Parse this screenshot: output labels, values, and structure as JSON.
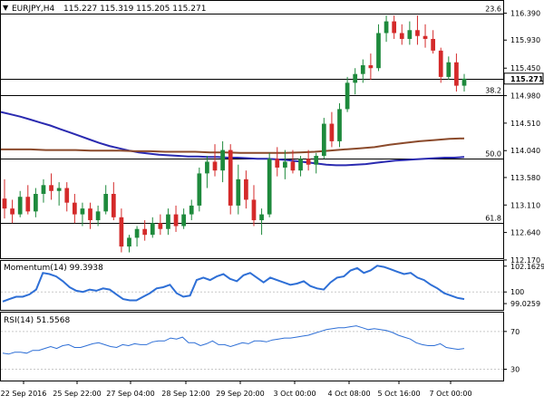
{
  "colors": {
    "bull": "#1e8a3c",
    "bear": "#d42a2a",
    "sma_blue": "#2a2ab0",
    "sma_brown": "#8b4a2b",
    "indicator": "#2e6fd6",
    "grid": "#c8c8c8",
    "frame": "#000000",
    "text": "#000000"
  },
  "header": {
    "symbol_timeframe": "EURJPY,H4",
    "ohlc": "115.227 115.319 115.205 115.271"
  },
  "chart_data": [
    {
      "type": "candlestick",
      "panel": "price",
      "ylim": [
        112.2,
        116.6
      ],
      "yticks": [
        "116.390",
        "115.930",
        "115.450",
        "114.980",
        "114.510",
        "114.040",
        "113.580",
        "113.110",
        "112.640",
        "112.170"
      ],
      "current_price": "115.271",
      "hlines": [
        {
          "label": "23.6",
          "value": 116.39
        },
        {
          "label": "38.2",
          "value": 114.99
        },
        {
          "label": "50.0",
          "value": 113.91
        },
        {
          "label": "61.8",
          "value": 112.81
        },
        {
          "label": "",
          "value": 115.27
        }
      ],
      "candles": [
        {
          "o": 113.22,
          "h": 113.55,
          "l": 112.88,
          "c": 113.05
        },
        {
          "o": 113.05,
          "h": 113.2,
          "l": 112.8,
          "c": 112.95
        },
        {
          "o": 112.95,
          "h": 113.35,
          "l": 112.9,
          "c": 113.25
        },
        {
          "o": 113.25,
          "h": 113.45,
          "l": 112.95,
          "c": 113.0
        },
        {
          "o": 113.0,
          "h": 113.4,
          "l": 112.9,
          "c": 113.3
        },
        {
          "o": 113.3,
          "h": 113.55,
          "l": 113.15,
          "c": 113.45
        },
        {
          "o": 113.45,
          "h": 113.65,
          "l": 113.2,
          "c": 113.35
        },
        {
          "o": 113.35,
          "h": 113.5,
          "l": 113.1,
          "c": 113.4
        },
        {
          "o": 113.4,
          "h": 113.5,
          "l": 113.0,
          "c": 113.15
        },
        {
          "o": 113.15,
          "h": 113.3,
          "l": 112.8,
          "c": 112.95
        },
        {
          "o": 112.95,
          "h": 113.15,
          "l": 112.75,
          "c": 113.05
        },
        {
          "o": 113.05,
          "h": 113.15,
          "l": 112.7,
          "c": 112.85
        },
        {
          "o": 112.85,
          "h": 113.1,
          "l": 112.75,
          "c": 113.0
        },
        {
          "o": 113.0,
          "h": 113.45,
          "l": 112.95,
          "c": 113.3
        },
        {
          "o": 113.3,
          "h": 113.5,
          "l": 112.85,
          "c": 112.9
        },
        {
          "o": 112.9,
          "h": 113.05,
          "l": 112.3,
          "c": 112.4
        },
        {
          "o": 112.4,
          "h": 112.6,
          "l": 112.3,
          "c": 112.55
        },
        {
          "o": 112.55,
          "h": 112.75,
          "l": 112.4,
          "c": 112.7
        },
        {
          "o": 112.7,
          "h": 112.85,
          "l": 112.5,
          "c": 112.6
        },
        {
          "o": 112.6,
          "h": 112.9,
          "l": 112.55,
          "c": 112.8
        },
        {
          "o": 112.8,
          "h": 112.95,
          "l": 112.6,
          "c": 112.7
        },
        {
          "o": 112.7,
          "h": 113.05,
          "l": 112.6,
          "c": 112.95
        },
        {
          "o": 112.95,
          "h": 113.1,
          "l": 112.65,
          "c": 112.75
        },
        {
          "o": 112.75,
          "h": 113.05,
          "l": 112.7,
          "c": 112.95
        },
        {
          "o": 112.95,
          "h": 113.2,
          "l": 112.85,
          "c": 113.1
        },
        {
          "o": 113.1,
          "h": 113.75,
          "l": 113.0,
          "c": 113.65
        },
        {
          "o": 113.65,
          "h": 113.95,
          "l": 113.4,
          "c": 113.85
        },
        {
          "o": 113.85,
          "h": 114.15,
          "l": 113.6,
          "c": 113.7
        },
        {
          "o": 113.7,
          "h": 114.2,
          "l": 113.5,
          "c": 114.05
        },
        {
          "o": 114.05,
          "h": 114.15,
          "l": 112.95,
          "c": 113.1
        },
        {
          "o": 113.1,
          "h": 113.8,
          "l": 112.95,
          "c": 113.55
        },
        {
          "o": 113.55,
          "h": 113.7,
          "l": 113.05,
          "c": 113.2
        },
        {
          "o": 113.2,
          "h": 113.45,
          "l": 112.75,
          "c": 112.85
        },
        {
          "o": 112.85,
          "h": 113.05,
          "l": 112.6,
          "c": 112.95
        },
        {
          "o": 112.95,
          "h": 114.0,
          "l": 112.9,
          "c": 113.9
        },
        {
          "o": 113.9,
          "h": 114.1,
          "l": 113.6,
          "c": 113.75
        },
        {
          "o": 113.75,
          "h": 114.05,
          "l": 113.55,
          "c": 113.85
        },
        {
          "o": 113.85,
          "h": 114.05,
          "l": 113.65,
          "c": 113.7
        },
        {
          "o": 113.7,
          "h": 113.95,
          "l": 113.6,
          "c": 113.9
        },
        {
          "o": 113.9,
          "h": 114.05,
          "l": 113.7,
          "c": 113.8
        },
        {
          "o": 113.8,
          "h": 114.0,
          "l": 113.65,
          "c": 113.95
        },
        {
          "o": 113.95,
          "h": 114.6,
          "l": 113.9,
          "c": 114.5
        },
        {
          "o": 114.5,
          "h": 114.7,
          "l": 114.1,
          "c": 114.2
        },
        {
          "o": 114.2,
          "h": 114.85,
          "l": 114.1,
          "c": 114.75
        },
        {
          "o": 114.75,
          "h": 115.3,
          "l": 114.7,
          "c": 115.2
        },
        {
          "o": 115.2,
          "h": 115.45,
          "l": 115.0,
          "c": 115.35
        },
        {
          "o": 115.35,
          "h": 115.6,
          "l": 115.2,
          "c": 115.5
        },
        {
          "o": 115.5,
          "h": 115.7,
          "l": 115.25,
          "c": 115.45
        },
        {
          "o": 115.45,
          "h": 116.2,
          "l": 115.4,
          "c": 116.05
        },
        {
          "o": 116.05,
          "h": 116.35,
          "l": 115.9,
          "c": 116.25
        },
        {
          "o": 116.25,
          "h": 116.35,
          "l": 115.95,
          "c": 116.05
        },
        {
          "o": 116.05,
          "h": 116.2,
          "l": 115.85,
          "c": 115.95
        },
        {
          "o": 115.95,
          "h": 116.25,
          "l": 115.85,
          "c": 116.1
        },
        {
          "o": 116.1,
          "h": 116.35,
          "l": 115.85,
          "c": 116.0
        },
        {
          "o": 116.0,
          "h": 116.2,
          "l": 115.8,
          "c": 115.95
        },
        {
          "o": 115.95,
          "h": 116.1,
          "l": 115.7,
          "c": 115.75
        },
        {
          "o": 115.75,
          "h": 115.8,
          "l": 115.2,
          "c": 115.3
        },
        {
          "o": 115.3,
          "h": 115.65,
          "l": 115.25,
          "c": 115.55
        },
        {
          "o": 115.55,
          "h": 115.7,
          "l": 115.05,
          "c": 115.15
        },
        {
          "o": 115.15,
          "h": 115.35,
          "l": 115.05,
          "c": 115.27
        }
      ],
      "series": [
        {
          "values": [
            114.7,
            114.66,
            114.62,
            114.57,
            114.52,
            114.47,
            114.41,
            114.35,
            114.29,
            114.23,
            114.17,
            114.12,
            114.08,
            114.04,
            114.01,
            113.99,
            113.97,
            113.96,
            113.95,
            113.94,
            113.94,
            113.93,
            113.93,
            113.92,
            113.92,
            113.91,
            113.9,
            113.9,
            113.89,
            113.88,
            113.86,
            113.84,
            113.82,
            113.8,
            113.79,
            113.79,
            113.8,
            113.81,
            113.83,
            113.85,
            113.87,
            113.88,
            113.89,
            113.9,
            113.91,
            113.92,
            113.92,
            113.93
          ]
        },
        {
          "values": [
            114.06,
            114.06,
            114.06,
            114.05,
            114.05,
            114.05,
            114.04,
            114.04,
            114.04,
            114.03,
            114.03,
            114.02,
            114.02,
            114.02,
            114.01,
            114.01,
            114.0,
            114.0,
            114.0,
            114.0,
            114.01,
            114.02,
            114.04,
            114.06,
            114.08,
            114.1,
            114.14,
            114.17,
            114.2,
            114.22,
            114.24,
            114.25
          ]
        }
      ]
    },
    {
      "type": "line",
      "panel": "momentum",
      "title": "Momentum(14) 99.3938",
      "ylim": [
        98.5,
        102.6
      ],
      "yticks": [
        "102.1629",
        "100",
        "99.0259"
      ],
      "hlines": [
        100
      ],
      "values": [
        99.2,
        99.4,
        99.6,
        99.6,
        99.8,
        100.2,
        101.6,
        101.5,
        101.3,
        100.9,
        100.4,
        100.1,
        100.0,
        100.2,
        100.1,
        100.3,
        100.2,
        99.8,
        99.4,
        99.3,
        99.3,
        99.6,
        99.9,
        100.3,
        100.4,
        100.6,
        99.9,
        99.6,
        99.7,
        101.0,
        101.2,
        101.0,
        101.3,
        101.5,
        101.1,
        100.9,
        101.4,
        101.6,
        101.2,
        100.8,
        101.2,
        101.0,
        100.8,
        100.6,
        100.7,
        100.9,
        100.5,
        100.3,
        100.2,
        100.8,
        101.2,
        101.3,
        101.8,
        102.0,
        101.6,
        101.8,
        102.2,
        102.1,
        101.9,
        101.7,
        101.5,
        101.6,
        101.2,
        101.0,
        100.6,
        100.3,
        99.9,
        99.7,
        99.5,
        99.4
      ]
    },
    {
      "type": "line",
      "panel": "rsi",
      "title": "RSI(14) 51.5568",
      "ylim": [
        18,
        90
      ],
      "yticks": [
        "70",
        "30"
      ],
      "hlines": [
        70,
        30
      ],
      "values": [
        47,
        46,
        48,
        48,
        47,
        50,
        50,
        52,
        54,
        52,
        55,
        56,
        53,
        53,
        55,
        57,
        58,
        56,
        54,
        53,
        56,
        55,
        57,
        56,
        56,
        59,
        60,
        60,
        63,
        62,
        64,
        58,
        58,
        55,
        57,
        60,
        56,
        56,
        54,
        56,
        58,
        57,
        60,
        60,
        59,
        61,
        62,
        63,
        63,
        64,
        65,
        66,
        68,
        70,
        72,
        73,
        74,
        74,
        75,
        76,
        74,
        72,
        73,
        72,
        71,
        69,
        66,
        64,
        62,
        58,
        56,
        55,
        55,
        57,
        53,
        52,
        51,
        52
      ]
    },
    {
      "type": "axis",
      "xticks": [
        "22 Sep 2016",
        "25 Sep 22:00",
        "27 Sep 04:00",
        "28 Sep 12:00",
        "29 Sep 20:00",
        "3 Oct 00:00",
        "4 Oct 08:00",
        "5 Oct 16:00",
        "7 Oct 00:00"
      ]
    }
  ]
}
